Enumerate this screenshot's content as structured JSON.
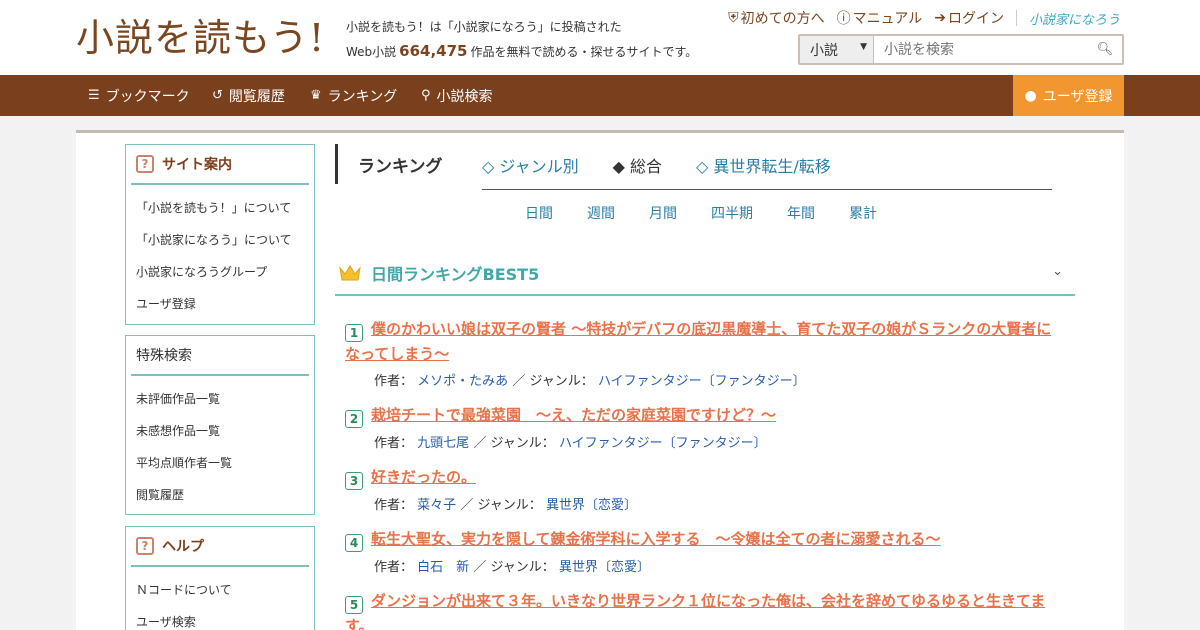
{
  "header": {
    "logo": "小説を読もう!",
    "tagline_line1": "小説を読もう！は「小説家になろう」に投稿された",
    "tagline_prefix": "Web小説",
    "work_count": "664,475",
    "tagline_suffix": "作品を無料で読める・探せるサイトです。",
    "links": [
      "初めての方へ",
      "マニュアル",
      "ログイン"
    ],
    "narou_logo": "小説家になろう",
    "search": {
      "select_value": "小説",
      "placeholder": "小説を検索"
    }
  },
  "nav": {
    "items": [
      "ブックマーク",
      "閲覧履歴",
      "ランキング",
      "小説検索"
    ],
    "register": "ユーザ登録"
  },
  "sidebar": {
    "site_guide": {
      "title": "サイト案内",
      "items": [
        "「小説を読もう！」について",
        "「小説家になろう」について",
        "小説家になろうグループ",
        "ユーザ登録"
      ]
    },
    "special": {
      "title": "特殊検索",
      "items": [
        "未評価作品一覧",
        "未感想作品一覧",
        "平均点順作者一覧",
        "閲覧履歴"
      ]
    },
    "help": {
      "title": "ヘルプ",
      "items": [
        "Ｎコードについて",
        "ユーザ検索"
      ]
    }
  },
  "ranking": {
    "heading": "ランキング",
    "tabs": [
      "◇ ジャンル別",
      "◆ 総合",
      "◇ 異世界転生/転移"
    ],
    "periods": [
      "日間",
      "週間",
      "月間",
      "四半期",
      "年間",
      "累計"
    ],
    "best_title": "日間ランキングBEST5",
    "author_label": "作者：",
    "genre_label": "／ ジャンル：",
    "items": [
      {
        "rank": "1",
        "title": "僕のかわいい娘は双子の賢者 ～特技がデバフの底辺黒魔導士、育てた双子の娘がＳランクの大賢者になってしまう～",
        "author": "メソポ・たみあ",
        "genre": "ハイファンタジー〔ファンタジー〕"
      },
      {
        "rank": "2",
        "title": "栽培チートで最強菜園　～え、ただの家庭菜園ですけど？～",
        "author": "九頭七尾",
        "genre": "ハイファンタジー〔ファンタジー〕"
      },
      {
        "rank": "3",
        "title": "好きだったの。",
        "author": "菜々子",
        "genre": "異世界〔恋愛〕"
      },
      {
        "rank": "4",
        "title": "転生大聖女、実力を隠して錬金術学科に入学する　～令嬢は全ての者に溺愛される～",
        "author": "白石　新",
        "genre": "異世界〔恋愛〕"
      },
      {
        "rank": "5",
        "title": "ダンジョンが出来て３年。いきなり世界ランク１位になった俺は、会社を辞めてゆるゆると生きてます。",
        "author": "",
        "genre": ""
      }
    ]
  }
}
